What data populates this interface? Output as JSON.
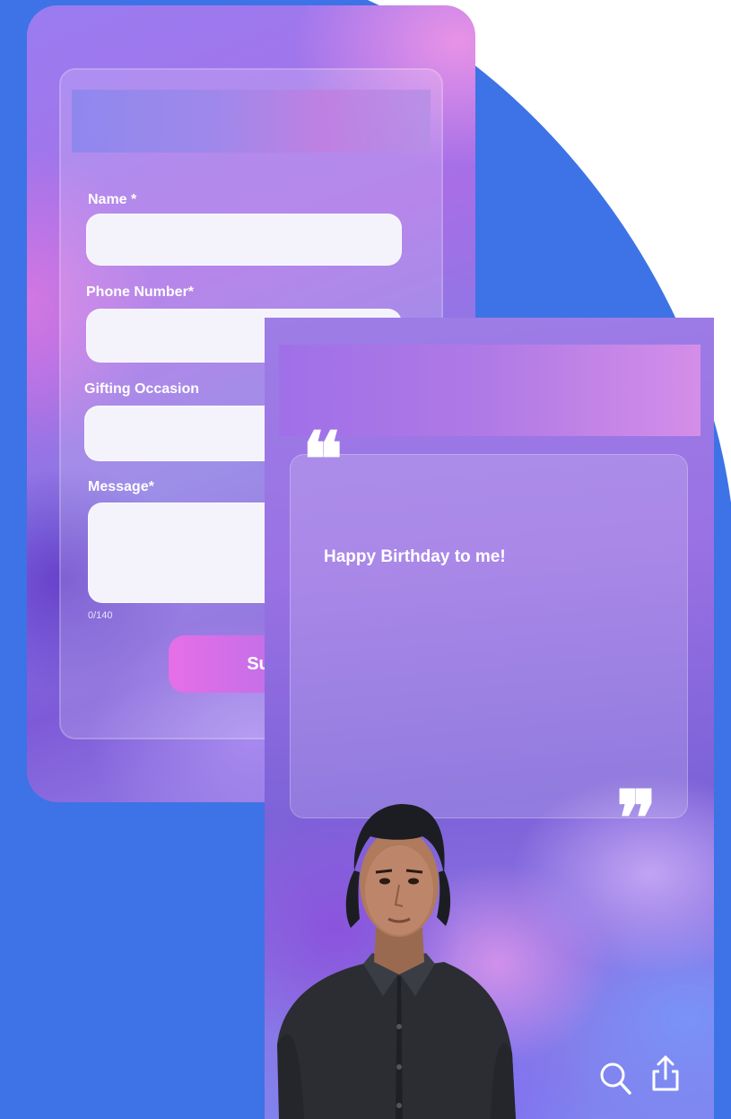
{
  "form": {
    "fields": [
      {
        "label": "Name *"
      },
      {
        "label": "Phone Number*"
      },
      {
        "label": "Gifting Occasion"
      },
      {
        "label": "Message*"
      }
    ],
    "char_counter": "0/140",
    "submit_label": "Subm"
  },
  "message_card": {
    "text": "Happy Birthday to me!",
    "open_quote": "❝",
    "close_quote": "❞"
  },
  "actions": {
    "icons": [
      "search-icon",
      "share-icon"
    ]
  },
  "colors": {
    "background_blue": "#3d73e6",
    "submit_gradient_start": "#e66fe7",
    "submit_gradient_end": "#9a6fe8"
  }
}
